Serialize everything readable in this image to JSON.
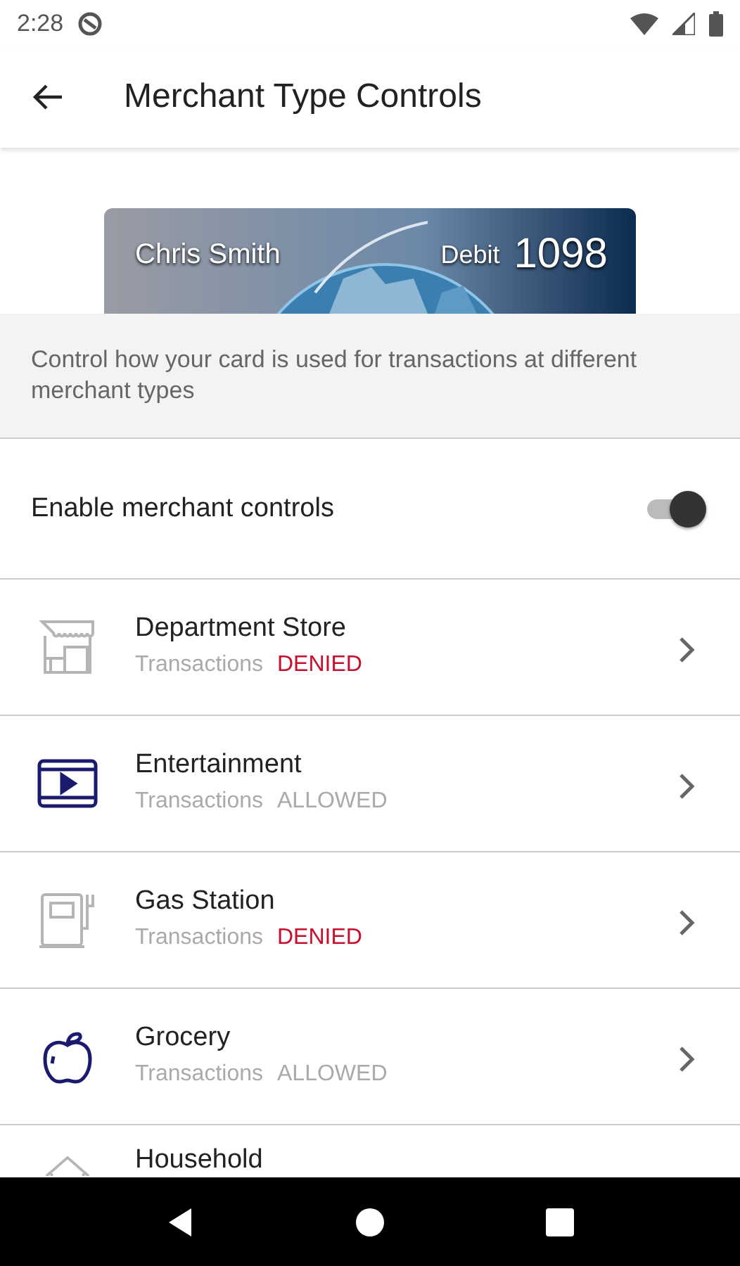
{
  "status_bar": {
    "time": "2:28"
  },
  "app_bar": {
    "title": "Merchant Type Controls"
  },
  "card": {
    "holder": "Chris Smith",
    "type": "Debit",
    "number": "1098"
  },
  "description": "Control how your card is used for transactions at different merchant types",
  "master_toggle": {
    "label": "Enable merchant controls",
    "on": true
  },
  "merchants": [
    {
      "kind": "store",
      "name": "Department Store",
      "label": "Transactions",
      "status": "DENIED",
      "allowed": false
    },
    {
      "kind": "film",
      "name": "Entertainment",
      "label": "Transactions",
      "status": "ALLOWED",
      "allowed": true
    },
    {
      "kind": "fuel",
      "name": "Gas Station",
      "label": "Transactions",
      "status": "DENIED",
      "allowed": false
    },
    {
      "kind": "apple",
      "name": "Grocery",
      "label": "Transactions",
      "status": "ALLOWED",
      "allowed": true
    },
    {
      "kind": "house",
      "name": "Household"
    }
  ]
}
